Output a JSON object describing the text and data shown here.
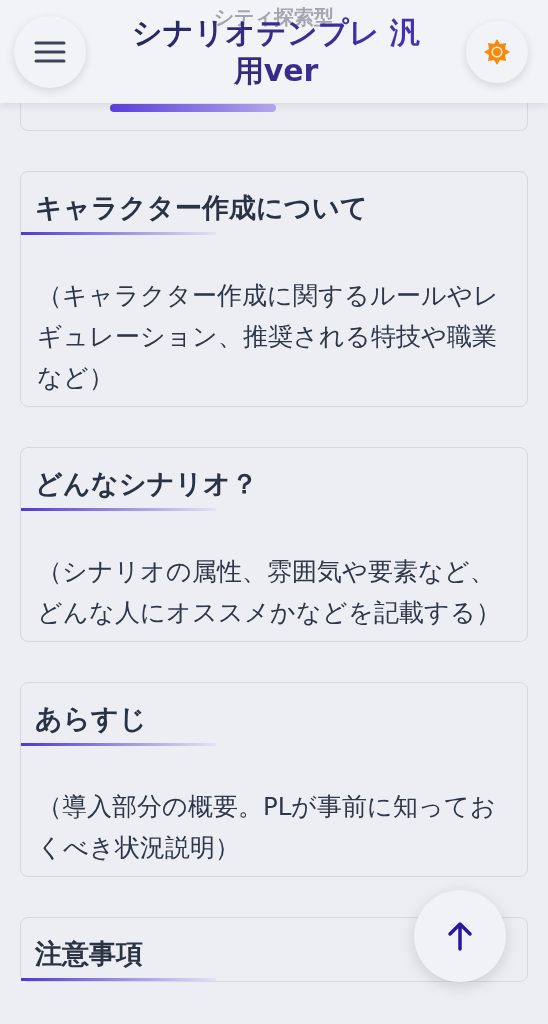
{
  "header": {
    "subtitle": "シティ探索型",
    "title": "シナリオテンプレ 汎用ver"
  },
  "sections": [
    {
      "heading": "キャラクター作成について",
      "body": "（キャラクター作成に関するルールやレギュレーション、推奨される特技や職業など）"
    },
    {
      "heading": "どんなシナリオ？",
      "body": "（シナリオの属性、雰囲気や要素など、どんな人にオススメかなどを記載する）"
    },
    {
      "heading": "あらすじ",
      "body": "（導入部分の概要。PLが事前に知っておくべき状況説明）"
    },
    {
      "heading": "注意事項"
    }
  ]
}
